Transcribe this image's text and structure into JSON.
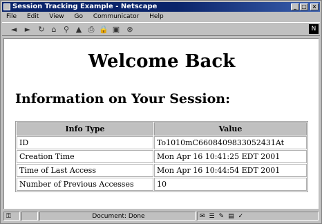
{
  "window": {
    "title": "Session Tracking Example - Netscape",
    "controls": [
      "_",
      "□",
      "×"
    ]
  },
  "menu": [
    "File",
    "Edit",
    "View",
    "Go",
    "Communicator",
    "Help"
  ],
  "toolbar": {
    "icons": [
      "back-icon",
      "forward-icon",
      "reload-icon",
      "home-icon",
      "search-icon",
      "netscape-guide-icon",
      "print-icon",
      "security-icon",
      "shop-icon",
      "stop-icon"
    ],
    "glyphs": [
      "◄",
      "►",
      "↻",
      "⌂",
      "⚲",
      "▲",
      "⎙",
      "🔒",
      "▣",
      "⊗"
    ]
  },
  "page": {
    "heading": "Welcome Back",
    "subheading": "Information on Your Session:",
    "table": {
      "headers": [
        "Info Type",
        "Value"
      ],
      "rows": [
        [
          "ID",
          "To1010mC6608409833052431At"
        ],
        [
          "Creation Time",
          "Mon Apr 16 10:41:25 EDT 2001"
        ],
        [
          "Time of Last Access",
          "Mon Apr 16 10:44:54 EDT 2001"
        ],
        [
          "Number of Previous Accesses",
          "10"
        ]
      ]
    }
  },
  "status": {
    "text": "Document: Done"
  }
}
